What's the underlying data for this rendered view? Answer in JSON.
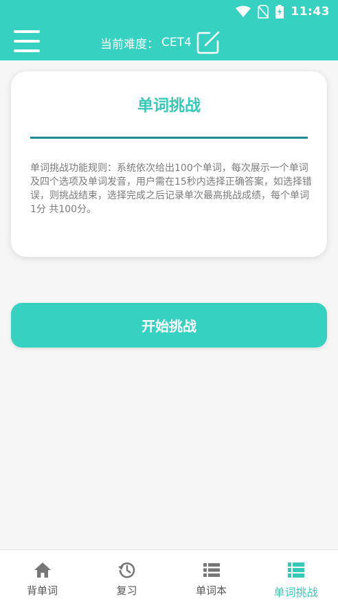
{
  "status_bar": {
    "time": "11:43",
    "icons": [
      "wifi-icon",
      "no-sim-icon",
      "battery-charging-icon"
    ]
  },
  "header": {
    "menu_icon": "hamburger-menu-icon",
    "difficulty_label": "当前难度：",
    "difficulty_value": "CET4",
    "edit_icon": "edit-icon"
  },
  "card": {
    "title": "单词挑战",
    "rules": "单词挑战功能规则：系统依次给出100个单词，每次展示一个单词及四个选项及单词发音，用户需在15秒内选择正确答案，如选择错误，则挑战结束，选择完成之后记录单次最高挑战成绩，每个单词1分 共100分。"
  },
  "start_button": {
    "label": "开始挑战"
  },
  "bottom_nav": {
    "items": [
      {
        "label": "背单词",
        "icon": "home-icon",
        "active": false
      },
      {
        "label": "复习",
        "icon": "history-icon",
        "active": false
      },
      {
        "label": "单词本",
        "icon": "list-icon",
        "active": false
      },
      {
        "label": "单词挑战",
        "icon": "list-icon",
        "active": true
      }
    ]
  },
  "colors": {
    "primary": "#36d1c0",
    "title_teal": "#36c9b8",
    "divider": "#1f8a93",
    "inactive_icon": "#777777",
    "rules_text": "#7a7a7a"
  }
}
